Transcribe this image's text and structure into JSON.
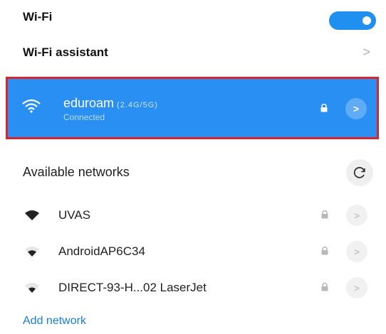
{
  "wifi": {
    "label": "Wi-Fi",
    "enabled": true
  },
  "assistant": {
    "label": "Wi-Fi assistant",
    "chevron": ">"
  },
  "connected_network": {
    "name": "eduroam",
    "band": "(2.4G/5G)",
    "status": "Connected",
    "icon": "wifi-icon",
    "detail": ">"
  },
  "available": {
    "title": "Available networks",
    "refresh_icon": "refresh-icon",
    "networks": [
      {
        "name": "UVAS",
        "detail": ">"
      },
      {
        "name": "AndroidAP6C34",
        "detail": ">"
      },
      {
        "name": "DIRECT-93-H...02 LaserJet",
        "detail": ">"
      }
    ]
  },
  "add_network": "Add network",
  "colors": {
    "accent": "#2a8ff2",
    "highlight_border": "#d7262b",
    "link": "#1a7fe0"
  }
}
